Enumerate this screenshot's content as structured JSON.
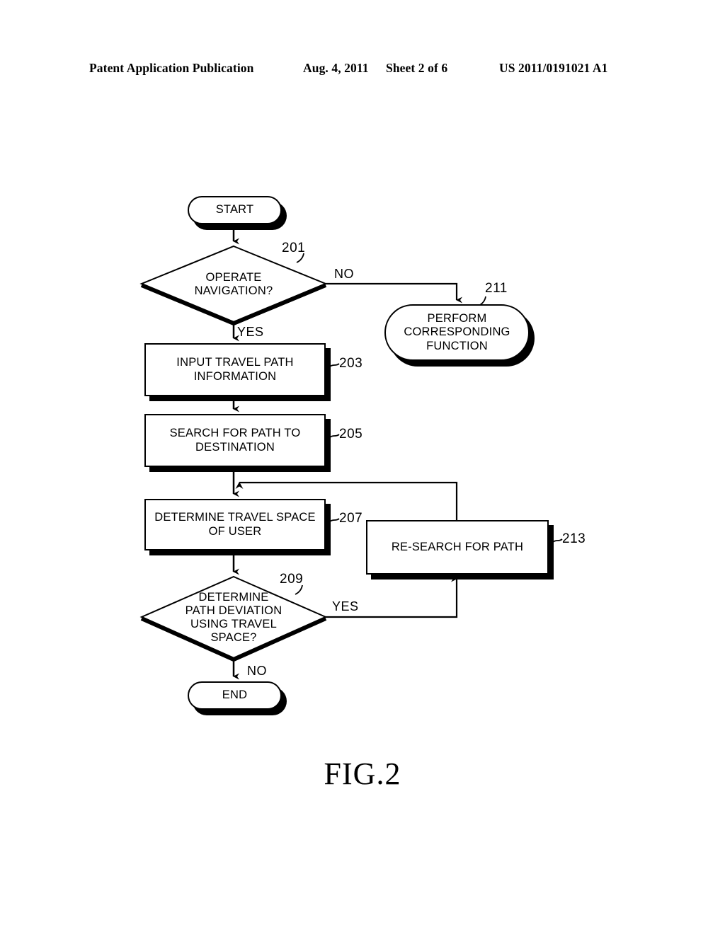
{
  "header": {
    "publication": "Patent Application Publication",
    "date": "Aug. 4, 2011",
    "sheet": "Sheet 2 of 6",
    "patent_number": "US 2011/0191021 A1"
  },
  "figure": {
    "caption": "FIG.2"
  },
  "chart_data": {
    "type": "diagram",
    "diagram_kind": "flowchart",
    "title": "FIG.2",
    "nodes": [
      {
        "id": "start",
        "shape": "terminal",
        "text": "START",
        "ref": ""
      },
      {
        "id": "d201",
        "shape": "decision",
        "text": "OPERATE\nNAVIGATION?",
        "ref": "201"
      },
      {
        "id": "p211",
        "shape": "terminal",
        "text": "PERFORM\nCORRESPONDING\nFUNCTION",
        "ref": "211"
      },
      {
        "id": "p203",
        "shape": "process",
        "text": "INPUT TRAVEL PATH\nINFORMATION",
        "ref": "203"
      },
      {
        "id": "p205",
        "shape": "process",
        "text": "SEARCH FOR PATH TO\nDESTINATION",
        "ref": "205"
      },
      {
        "id": "p207",
        "shape": "process",
        "text": "DETERMINE TRAVEL SPACE\nOF USER",
        "ref": "207"
      },
      {
        "id": "p213",
        "shape": "process",
        "text": "RE-SEARCH FOR PATH",
        "ref": "213"
      },
      {
        "id": "d209",
        "shape": "decision",
        "text": "DETERMINE\nPATH DEVIATION\nUSING TRAVEL\nSPACE?",
        "ref": "209"
      },
      {
        "id": "end",
        "shape": "terminal",
        "text": "END",
        "ref": ""
      }
    ],
    "edges": [
      {
        "from": "start",
        "to": "d201",
        "label": ""
      },
      {
        "from": "d201",
        "to": "p211",
        "label": "NO"
      },
      {
        "from": "d201",
        "to": "p203",
        "label": "YES"
      },
      {
        "from": "p203",
        "to": "p205",
        "label": ""
      },
      {
        "from": "p205",
        "to": "p207",
        "label": ""
      },
      {
        "from": "p207",
        "to": "d209",
        "label": ""
      },
      {
        "from": "d209",
        "to": "p213",
        "label": "YES"
      },
      {
        "from": "p213",
        "to": "p207",
        "label": ""
      },
      {
        "from": "d209",
        "to": "end",
        "label": "NO"
      }
    ]
  },
  "nodes": {
    "start": {
      "text": "START"
    },
    "d201": {
      "line1": "OPERATE",
      "line2": "NAVIGATION?",
      "ref": "201"
    },
    "p211": {
      "line1": "PERFORM",
      "line2": "CORRESPONDING",
      "line3": "FUNCTION",
      "ref": "211"
    },
    "p203": {
      "line1": "INPUT TRAVEL PATH",
      "line2": "INFORMATION",
      "ref": "203"
    },
    "p205": {
      "line1": "SEARCH FOR PATH TO",
      "line2": "DESTINATION",
      "ref": "205"
    },
    "p207": {
      "line1": "DETERMINE TRAVEL SPACE",
      "line2": "OF USER",
      "ref": "207"
    },
    "p213": {
      "line1": "RE-SEARCH FOR PATH",
      "ref": "213"
    },
    "d209": {
      "line1": "DETERMINE",
      "line2": "PATH DEVIATION",
      "line3": "USING TRAVEL",
      "line4": "SPACE?",
      "ref": "209"
    },
    "end": {
      "text": "END"
    }
  },
  "edge_labels": {
    "no_201": "NO",
    "yes_201": "YES",
    "yes_209": "YES",
    "no_209": "NO"
  },
  "colors": {
    "ink": "#000000",
    "paper": "#ffffff"
  }
}
